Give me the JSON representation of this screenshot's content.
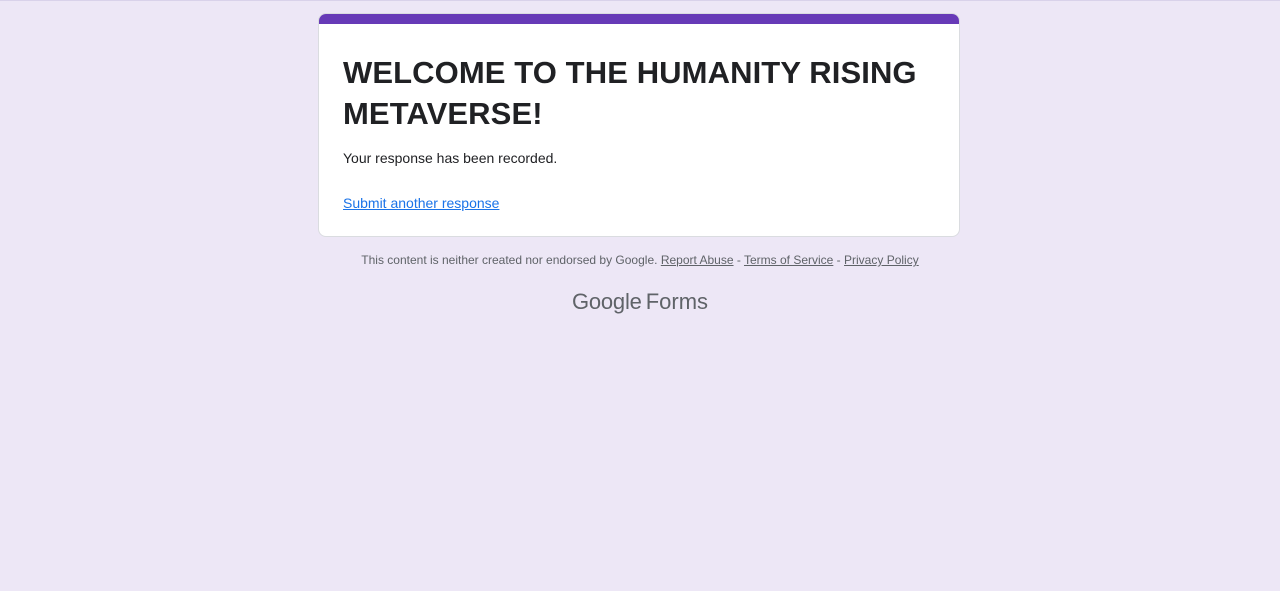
{
  "colors": {
    "background": "#ede7f6",
    "accent": "#673ab7",
    "link": "#1a73e8"
  },
  "card": {
    "title": "WELCOME TO THE HUMANITY RISING METAVERSE!",
    "message": "Your response has been recorded.",
    "submit_another_link": "Submit another response"
  },
  "footer": {
    "disclaimer": "This content is neither created nor endorsed by Google.",
    "separator": " - ",
    "report_abuse": "Report Abuse",
    "terms": "Terms of Service",
    "privacy": "Privacy Policy"
  },
  "branding": {
    "google": "Google",
    "forms": "Forms"
  }
}
